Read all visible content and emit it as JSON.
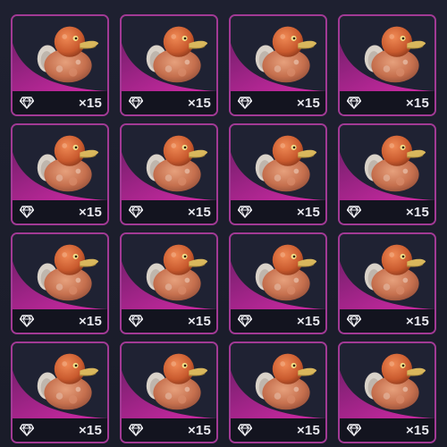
{
  "inventory": {
    "items": [
      {
        "icon": "rubber-duck-icon",
        "rarity_icon": "diamond-icon",
        "quantity": "×15"
      },
      {
        "icon": "rubber-duck-icon",
        "rarity_icon": "diamond-icon",
        "quantity": "×15"
      },
      {
        "icon": "rubber-duck-icon",
        "rarity_icon": "diamond-icon",
        "quantity": "×15"
      },
      {
        "icon": "rubber-duck-icon",
        "rarity_icon": "diamond-icon",
        "quantity": "×15"
      },
      {
        "icon": "rubber-duck-icon",
        "rarity_icon": "diamond-icon",
        "quantity": "×15"
      },
      {
        "icon": "rubber-duck-icon",
        "rarity_icon": "diamond-icon",
        "quantity": "×15"
      },
      {
        "icon": "rubber-duck-icon",
        "rarity_icon": "diamond-icon",
        "quantity": "×15"
      },
      {
        "icon": "rubber-duck-icon",
        "rarity_icon": "diamond-icon",
        "quantity": "×15"
      },
      {
        "icon": "rubber-duck-icon",
        "rarity_icon": "diamond-icon",
        "quantity": "×15"
      },
      {
        "icon": "rubber-duck-icon",
        "rarity_icon": "diamond-icon",
        "quantity": "×15"
      },
      {
        "icon": "rubber-duck-icon",
        "rarity_icon": "diamond-icon",
        "quantity": "×15"
      },
      {
        "icon": "rubber-duck-icon",
        "rarity_icon": "diamond-icon",
        "quantity": "×15"
      },
      {
        "icon": "rubber-duck-icon",
        "rarity_icon": "diamond-icon",
        "quantity": "×15"
      },
      {
        "icon": "rubber-duck-icon",
        "rarity_icon": "diamond-icon",
        "quantity": "×15"
      },
      {
        "icon": "rubber-duck-icon",
        "rarity_icon": "diamond-icon",
        "quantity": "×15"
      },
      {
        "icon": "rubber-duck-icon",
        "rarity_icon": "diamond-icon",
        "quantity": "×15"
      }
    ]
  },
  "colors": {
    "background": "#1b1d2b",
    "card_border": "#a23a95",
    "rarity_accent": "#c6289f",
    "quantity_text": "#e9e9ef"
  }
}
